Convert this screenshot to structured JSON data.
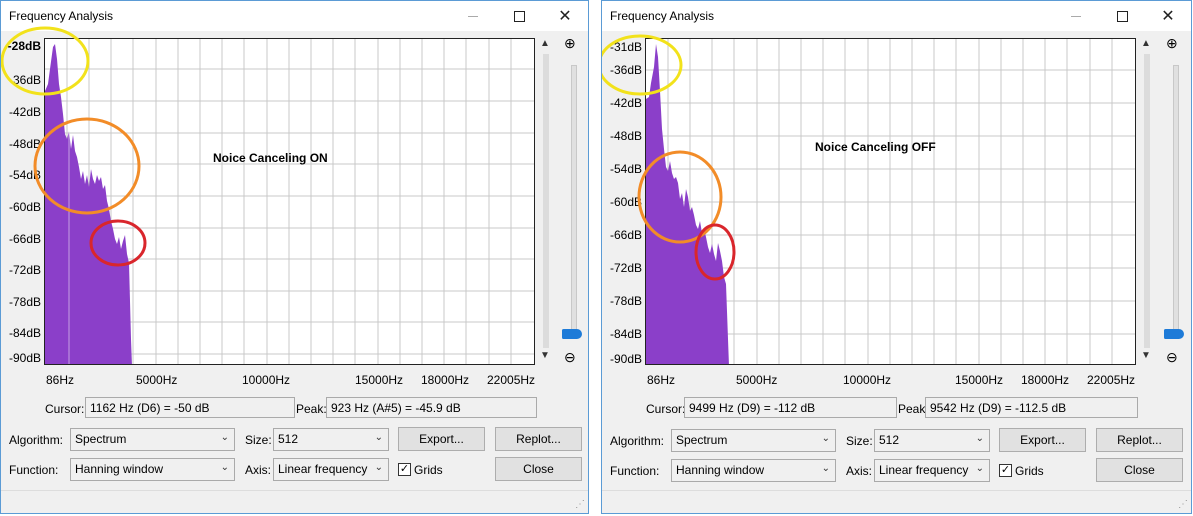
{
  "colors": {
    "spectrum": "#8b3fc9",
    "grid": "#c8c8c8",
    "accent": "#1e7bd8",
    "yellow": "#f2e21b",
    "orange": "#f28c28",
    "red": "#d9262c"
  },
  "icons": {
    "zoom_in": "zoom-in-icon",
    "zoom_out": "zoom-out-icon"
  },
  "windows": [
    {
      "title": "Frequency Analysis",
      "annotation": "Noice Canceling ON",
      "y_ticks": [
        "-28dB",
        "-36dB",
        "-42dB",
        "-48dB",
        "-54dB",
        "-60dB",
        "-66dB",
        "-72dB",
        "-78dB",
        "-84dB",
        "-90dB"
      ],
      "x_ticks": [
        "86Hz",
        "5000Hz",
        "10000Hz",
        "15000Hz",
        "18000Hz",
        "22005Hz"
      ],
      "cursor_label": "Cursor:",
      "cursor_value": "1162 Hz (D6) = -50 dB",
      "peak_label": "Peak:",
      "peak_value": "923 Hz (A#5) = -45.9 dB",
      "algorithm_label": "Algorithm:",
      "algorithm_value": "Spectrum",
      "size_label": "Size:",
      "size_value": "512",
      "function_label": "Function:",
      "function_value": "Hanning window",
      "axis_label": "Axis:",
      "axis_value": "Linear frequency",
      "grids_label": "Grids",
      "grids_checked": true,
      "export_label": "Export...",
      "replot_label": "Replot...",
      "close_label": "Close"
    },
    {
      "title": "Frequency Analysis",
      "annotation": "Noice Canceling OFF",
      "y_ticks": [
        "-31dB",
        "-36dB",
        "-42dB",
        "-48dB",
        "-54dB",
        "-60dB",
        "-66dB",
        "-72dB",
        "-78dB",
        "-84dB",
        "-90dB"
      ],
      "x_ticks": [
        "86Hz",
        "5000Hz",
        "10000Hz",
        "15000Hz",
        "18000Hz",
        "22005Hz"
      ],
      "cursor_label": "Cursor:",
      "cursor_value": "9499 Hz (D9) = -112 dB",
      "peak_label": "Peak:",
      "peak_value": "9542 Hz (D9) = -112.5 dB",
      "algorithm_label": "Algorithm:",
      "algorithm_value": "Spectrum",
      "size_label": "Size:",
      "size_value": "512",
      "function_label": "Function:",
      "function_value": "Hanning window",
      "axis_label": "Axis:",
      "axis_value": "Linear frequency",
      "grids_label": "Grids",
      "grids_checked": true,
      "export_label": "Export...",
      "replot_label": "Replot...",
      "close_label": "Close"
    }
  ]
}
